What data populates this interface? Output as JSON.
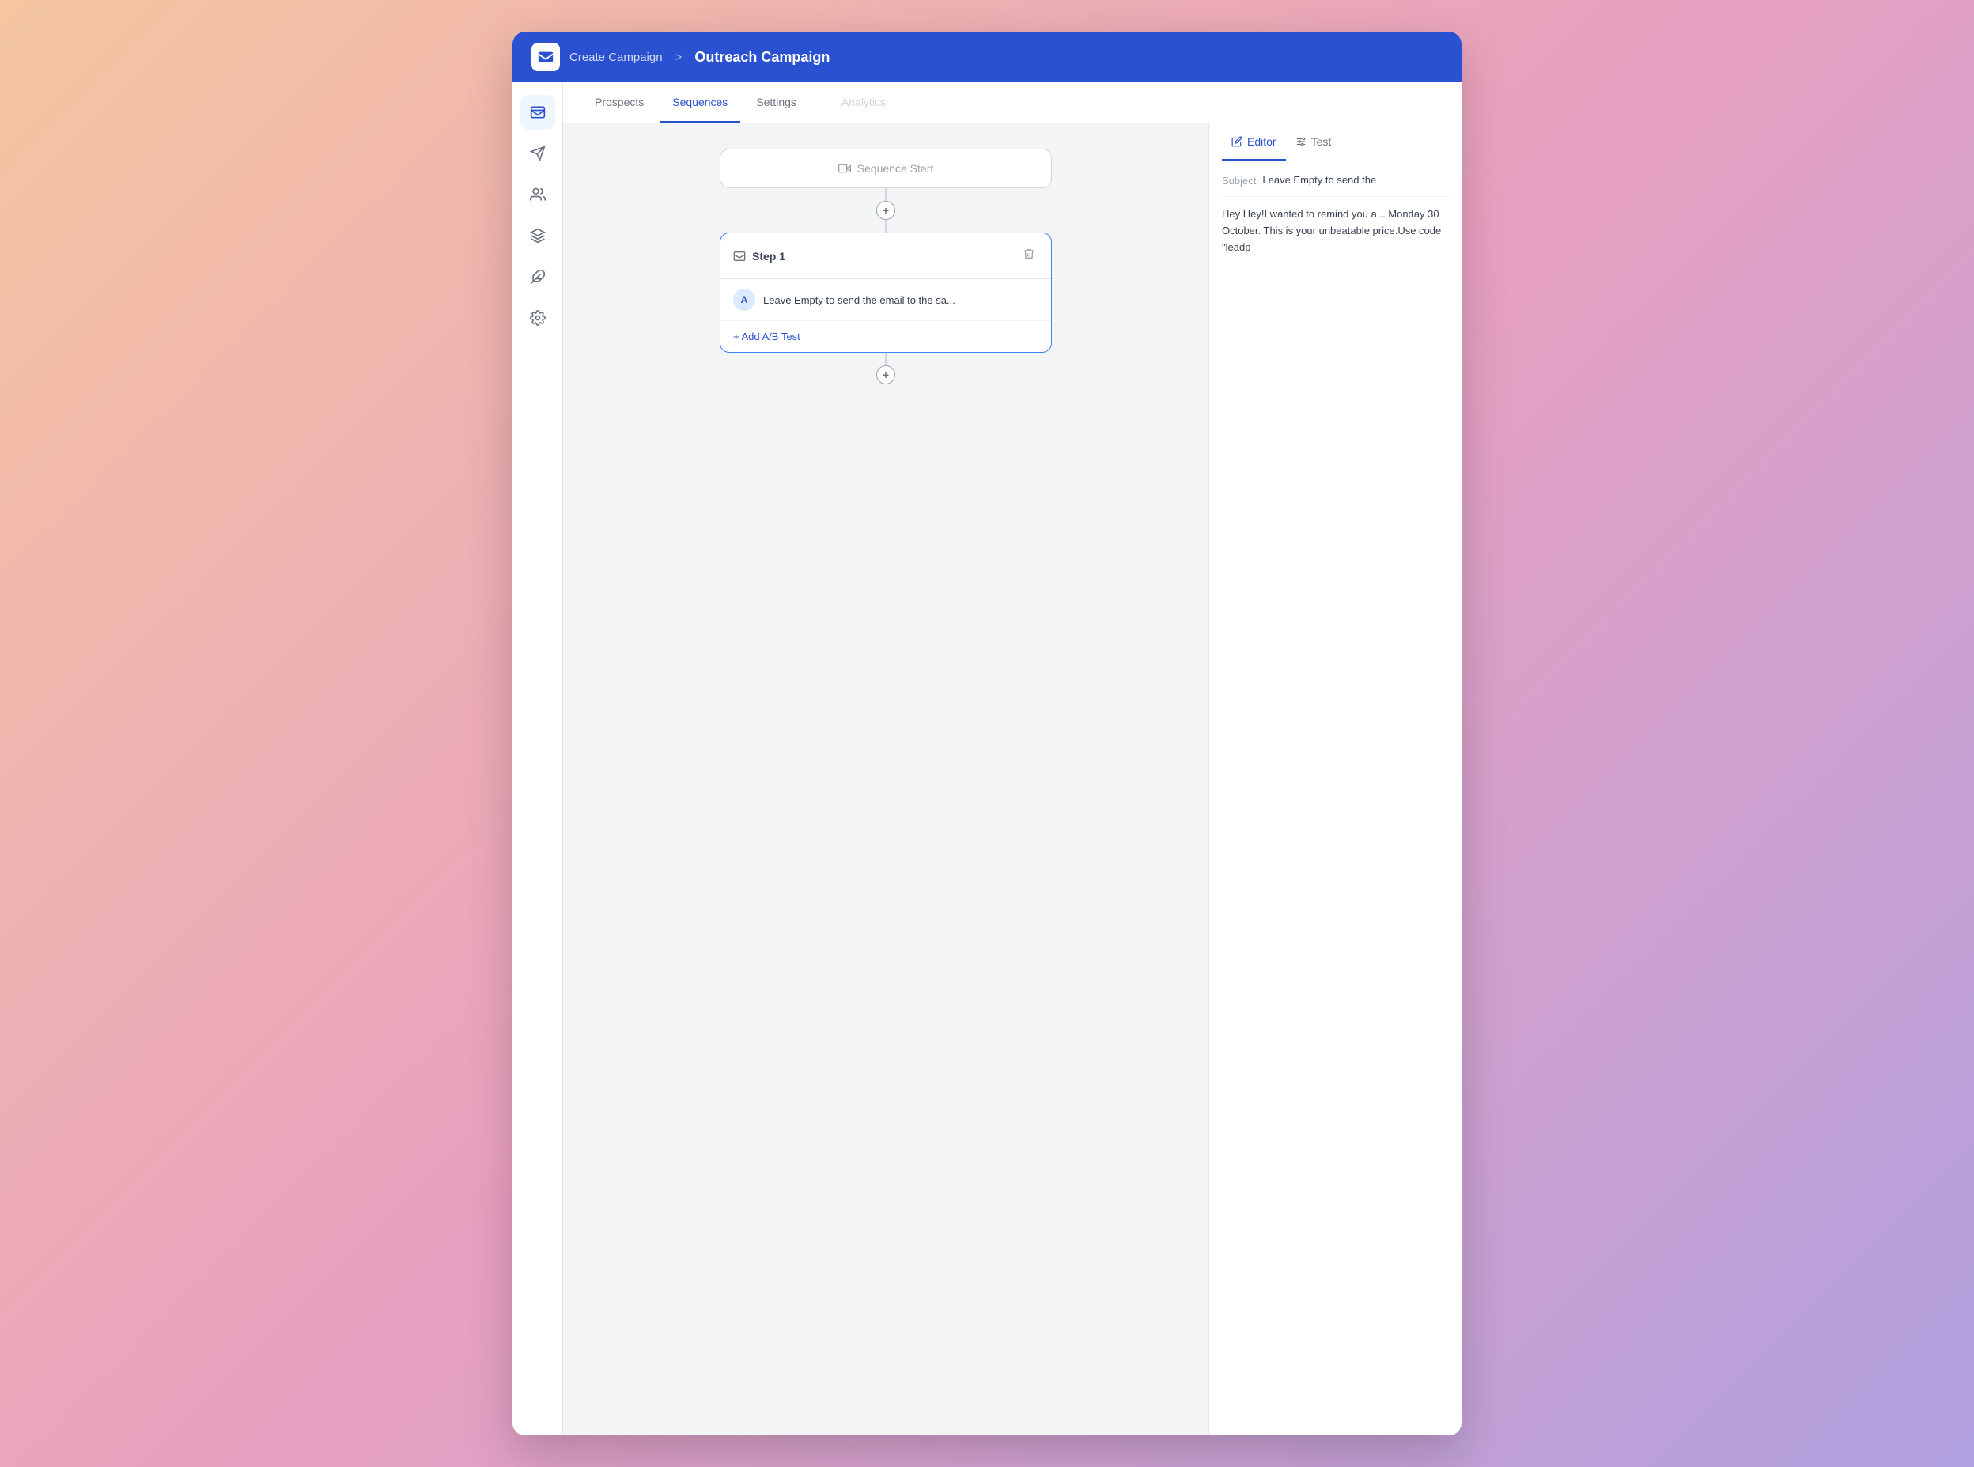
{
  "header": {
    "breadcrumb": "Create Campaign",
    "separator": ">",
    "title": "Outreach Campaign",
    "logo_alt": "mail-logo"
  },
  "sidebar": {
    "items": [
      {
        "name": "inbox",
        "icon": "inbox",
        "active": true
      },
      {
        "name": "send",
        "icon": "send",
        "active": false
      },
      {
        "name": "contacts",
        "icon": "contacts",
        "active": false
      },
      {
        "name": "layers",
        "icon": "layers",
        "active": false
      },
      {
        "name": "puzzle",
        "icon": "puzzle",
        "active": false
      },
      {
        "name": "settings",
        "icon": "settings",
        "active": false
      }
    ]
  },
  "tabs": [
    {
      "label": "Prospects",
      "active": false
    },
    {
      "label": "Sequences",
      "active": true
    },
    {
      "label": "Settings",
      "active": false
    },
    {
      "label": "Analytics",
      "active": false,
      "divider_before": true
    }
  ],
  "sequence": {
    "start_label": "Sequence Start",
    "steps": [
      {
        "id": "step1",
        "label": "Step 1",
        "variants": [
          {
            "avatar": "A",
            "text": "Leave Empty to send the email to the sa..."
          }
        ],
        "add_ab_label": "+ Add A/B Test"
      }
    ]
  },
  "editor": {
    "tabs": [
      {
        "label": "Editor",
        "active": true
      },
      {
        "label": "Test",
        "active": false
      }
    ],
    "subject_label": "Subject",
    "subject_value": "Leave Empty to send the",
    "body_text": "Hey Hey!I wanted to remind you a...\nMonday 30 October. This is your\nunbeatable price.Use code \"leadp"
  }
}
